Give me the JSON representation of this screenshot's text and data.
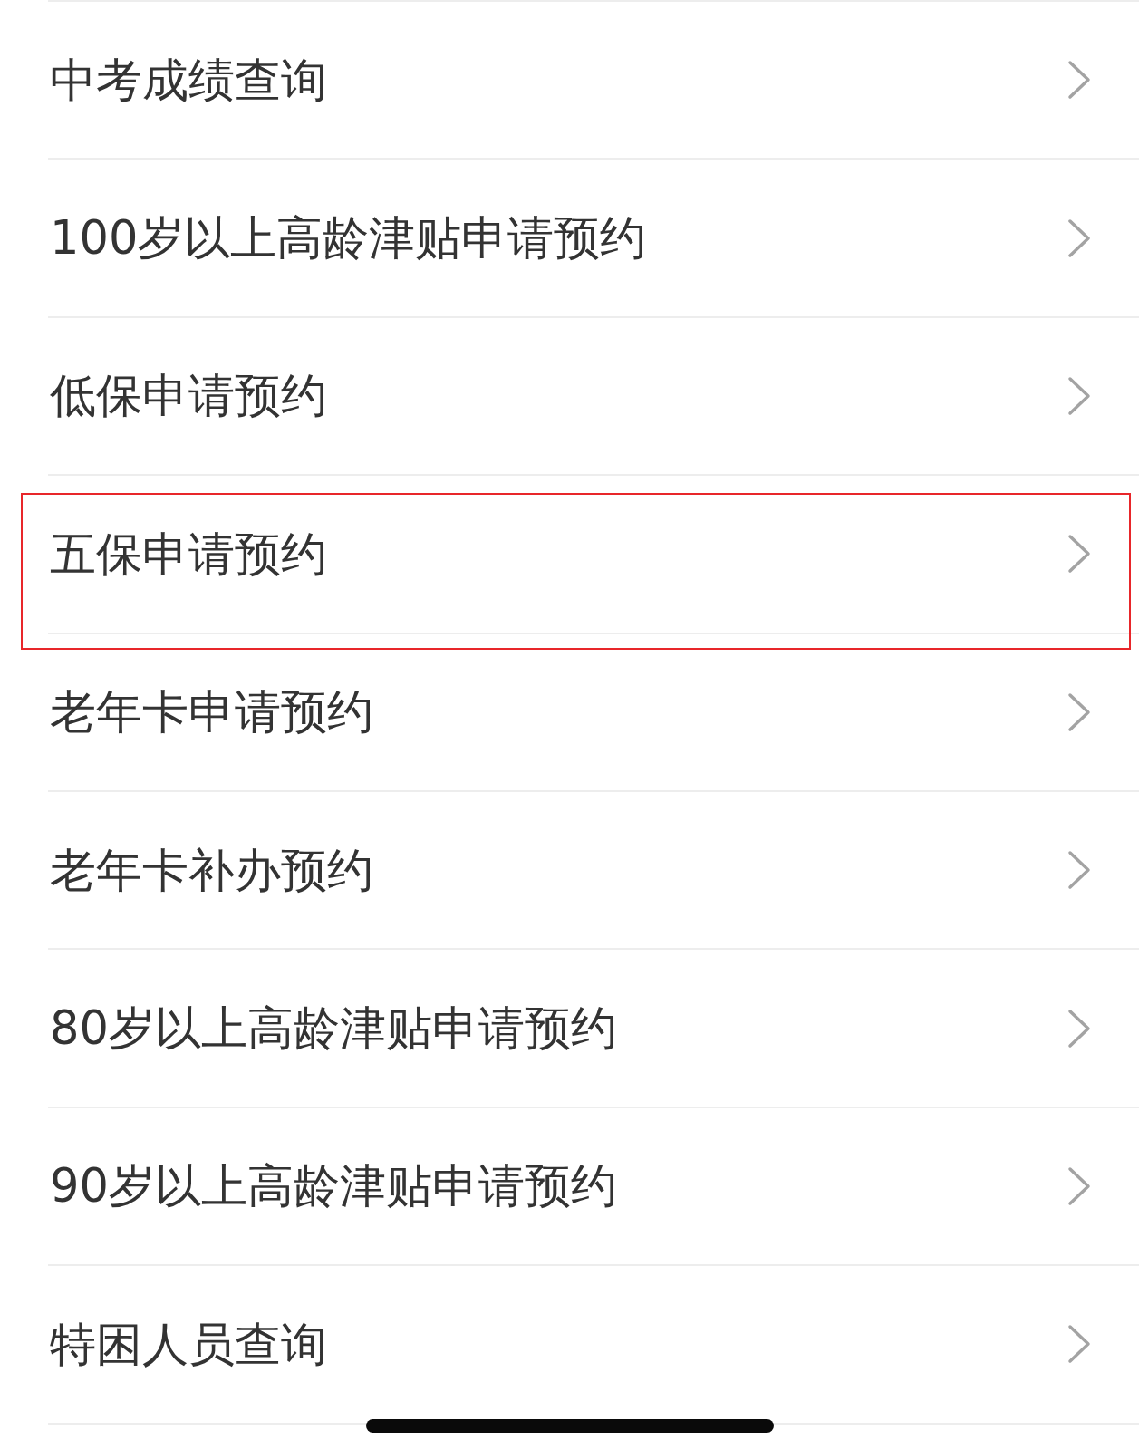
{
  "items": [
    {
      "label": "中考成绩查询",
      "highlighted": false
    },
    {
      "label": "100岁以上高龄津贴申请预约",
      "highlighted": false
    },
    {
      "label": "低保申请预约",
      "highlighted": false
    },
    {
      "label": "五保申请预约",
      "highlighted": true
    },
    {
      "label": "老年卡申请预约",
      "highlighted": false
    },
    {
      "label": "老年卡补办预约",
      "highlighted": false
    },
    {
      "label": "80岁以上高龄津贴申请预约",
      "highlighted": false
    },
    {
      "label": "90岁以上高龄津贴申请预约",
      "highlighted": false
    },
    {
      "label": "特困人员查询",
      "highlighted": false
    }
  ]
}
